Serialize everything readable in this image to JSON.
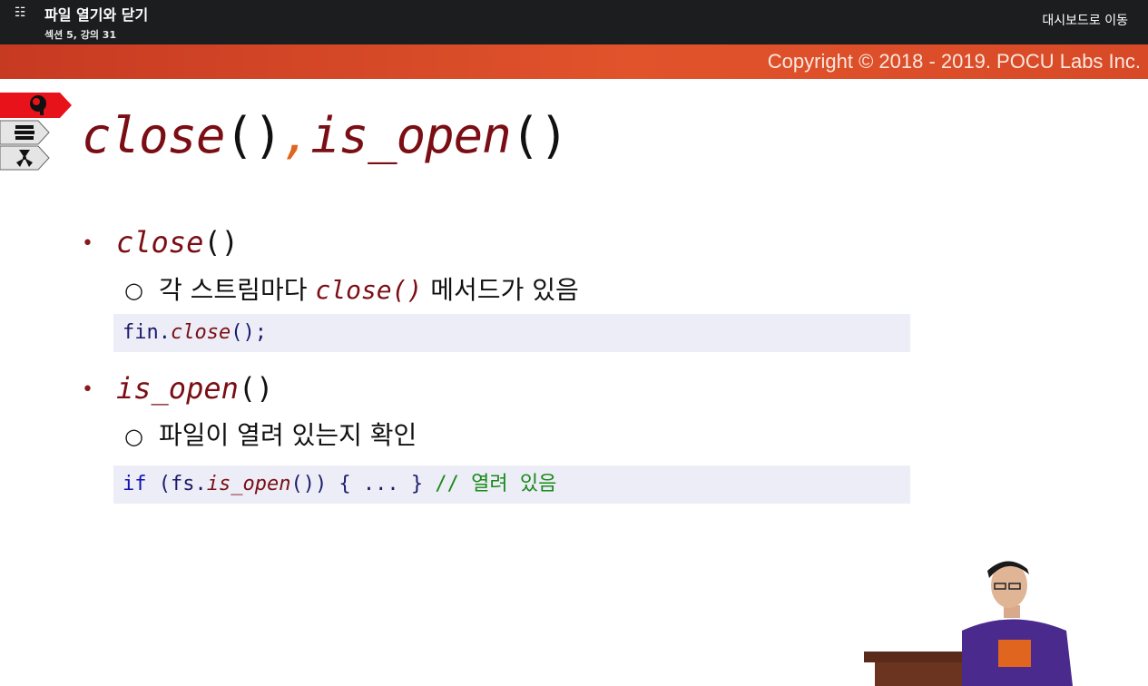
{
  "topbar": {
    "menu_icon": "list-icon",
    "title": "파일 열기와 닫기",
    "subtitle": "섹션 5, 강의 31",
    "dashboard_link": "대시보드로 이동"
  },
  "banner": {
    "copyright": "Copyright © 2018 - 2019. POCU Labs Inc.",
    "colors": {
      "start": "#c73a22",
      "end": "#e0532b"
    }
  },
  "side_tabs": [
    {
      "icon": "brain-icon",
      "active": true
    },
    {
      "icon": "books-icon",
      "active": false
    },
    {
      "icon": "radioactive-icon",
      "active": false
    }
  ],
  "slide": {
    "title_fn1": "close",
    "title_paren": "()",
    "title_comma": ",",
    "title_fn2": "is_open",
    "bullets": [
      {
        "fn": "close",
        "paren": "()",
        "sub_pre": "각 스트림마다 ",
        "sub_mono": "close()",
        "sub_post": " 메서드가 있음",
        "code": {
          "obj": "fin.",
          "fn": "close",
          "rest": "();"
        }
      },
      {
        "fn": "is_open",
        "paren": "()",
        "sub": "파일이 열려 있는지 확인",
        "code": {
          "kw": "if",
          "pre": " (fs.",
          "fn": "is_open",
          "rest": "()) { ... } ",
          "comment": "// 열려 있음"
        }
      }
    ]
  }
}
